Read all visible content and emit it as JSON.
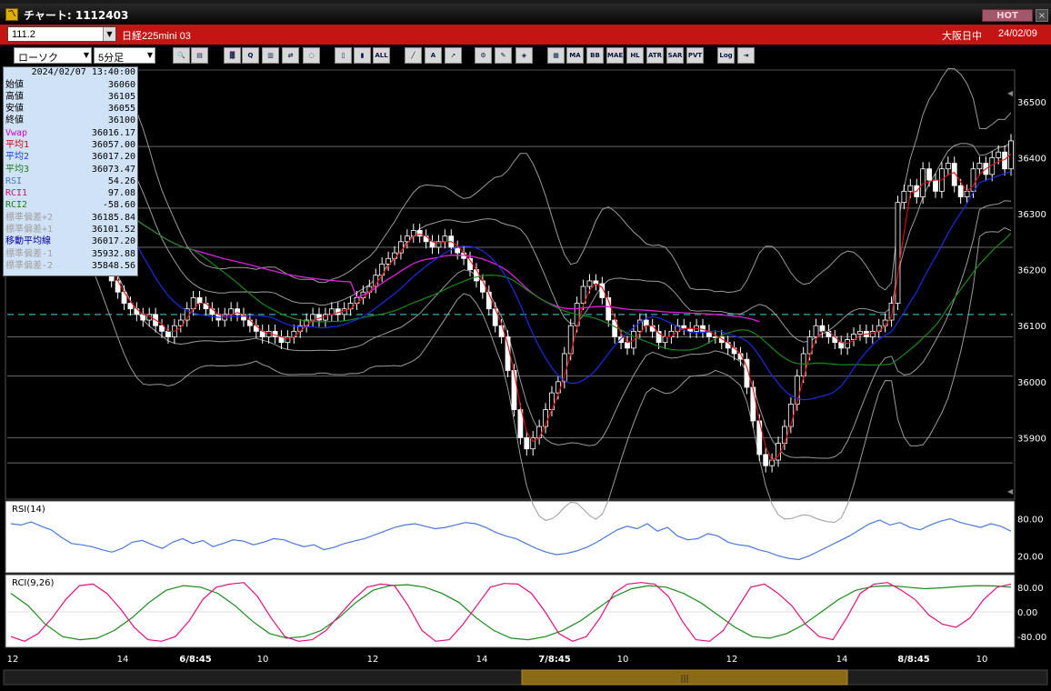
{
  "window": {
    "title": "チャート: 1112403",
    "hot_label": "HOT",
    "close_label": "×"
  },
  "instrument_bar": {
    "code": "111.2",
    "name": "日経225mini 03",
    "session": "大阪日中",
    "date": "24/02/09"
  },
  "toolbar": {
    "chart_type": "ローソク",
    "interval": "5分足",
    "buttons": [
      {
        "name": "zoom-icon",
        "label": "🔍"
      },
      {
        "name": "layout-icon",
        "label": "▤"
      },
      {
        "name": "candle-color-icon",
        "label": "▓"
      },
      {
        "name": "search-chart-icon",
        "label": "Q"
      },
      {
        "name": "bar-chart-icon",
        "label": "▥"
      },
      {
        "name": "swap-icon",
        "label": "⇄"
      },
      {
        "name": "disabled-tool-icon",
        "label": "◌"
      },
      {
        "name": "candle-type-a-icon",
        "label": "▯"
      },
      {
        "name": "candle-type-b-icon",
        "label": "▮"
      },
      {
        "name": "all-button",
        "label": "ALL"
      },
      {
        "name": "trendline-icon",
        "label": "╱"
      },
      {
        "name": "text-tool-icon",
        "label": "A"
      },
      {
        "name": "arrow-tool-icon",
        "label": "➚"
      },
      {
        "name": "settings-icon",
        "label": "⚙"
      },
      {
        "name": "color-tool-icon",
        "label": "✎"
      },
      {
        "name": "palette-icon",
        "label": "◈"
      },
      {
        "name": "grid-icon",
        "label": "▦"
      },
      {
        "name": "ma-button",
        "label": "MA"
      },
      {
        "name": "bb-button",
        "label": "BB"
      },
      {
        "name": "mae-button",
        "label": "MAE"
      },
      {
        "name": "hl-button",
        "label": "HL"
      },
      {
        "name": "atr-button",
        "label": "ATR"
      },
      {
        "name": "sar-button",
        "label": "SAR"
      },
      {
        "name": "pvt-button",
        "label": "PVT"
      },
      {
        "name": "log-button",
        "label": "Log"
      },
      {
        "name": "export-icon",
        "label": "⇥"
      }
    ]
  },
  "info_panel": {
    "timestamp": "2024/02/07  13:40:00",
    "rows": [
      {
        "label": "始値",
        "value": "36060",
        "color": "#000000"
      },
      {
        "label": "高値",
        "value": "36105",
        "color": "#000000"
      },
      {
        "label": "安値",
        "value": "36055",
        "color": "#000000"
      },
      {
        "label": "終値",
        "value": "36100",
        "color": "#000000"
      },
      {
        "label": "Vwap",
        "value": "36016.17",
        "color": "#cc00cc"
      },
      {
        "label": "平均1",
        "value": "36057.00",
        "color": "#d00000"
      },
      {
        "label": "平均2",
        "value": "36017.20",
        "color": "#1a3cd8"
      },
      {
        "label": "平均3",
        "value": "36073.47",
        "color": "#1a7a1a"
      },
      {
        "label": "RSI",
        "value": "54.26",
        "color": "#4a78c8"
      },
      {
        "label": "RCI1",
        "value": "97.08",
        "color": "#d0106a"
      },
      {
        "label": "RCI2",
        "value": "-58.60",
        "color": "#1a7a1a"
      },
      {
        "label": "標準偏差+2",
        "value": "36185.84",
        "color": "#a0a0a0"
      },
      {
        "label": "標準偏差+1",
        "value": "36101.52",
        "color": "#a0a0a0"
      },
      {
        "label": "移動平均線",
        "value": "36017.20",
        "color": "#0000a0"
      },
      {
        "label": "標準偏差-1",
        "value": "35932.88",
        "color": "#a0a0a0"
      },
      {
        "label": "標準偏差-2",
        "value": "35848.56",
        "color": "#a0a0a0"
      }
    ]
  },
  "price_axis": [
    "36500",
    "36400",
    "36300",
    "36200",
    "36100",
    "36000",
    "35900"
  ],
  "rsi_panel": {
    "title": "RSI(14)",
    "ticks": [
      "80.00",
      "20.00"
    ]
  },
  "rci_panel": {
    "title": "RCI(9,26)",
    "ticks": [
      "80.00",
      "0.00",
      "-80.00"
    ]
  },
  "time_axis": [
    "12",
    "14",
    "6/8:45",
    "10",
    "12",
    "14",
    "7/8:45",
    "10",
    "12",
    "14",
    "8/8:45",
    "10"
  ],
  "colors": {
    "candle": "#ffffff",
    "ma1": "#e01010",
    "ma2": "#1a2ce0",
    "ma3": "#1a8a1a",
    "vwap": "#e020e0",
    "bollinger": "#9a9a9a",
    "rsi": "#4a78d8",
    "rci1": "#e0107a",
    "rci2": "#1a8a1a",
    "dashed_level": "#2a9090",
    "scroll_thumb": "#8a6a14"
  },
  "chart_data": {
    "type": "candlestick",
    "price_range": [
      35800,
      36550
    ],
    "dashed_level": 36120,
    "horizontal_levels": [
      36420,
      36310,
      36240,
      36080,
      36010,
      35900,
      35855
    ],
    "closes": [
      36360,
      36370,
      36380,
      36365,
      36380,
      36390,
      36395,
      36400,
      36385,
      36370,
      36330,
      36290,
      36260,
      36240,
      36220,
      36200,
      36180,
      36160,
      36140,
      36130,
      36120,
      36110,
      36120,
      36100,
      36090,
      36080,
      36100,
      36110,
      36130,
      36150,
      36140,
      36130,
      36120,
      36110,
      36120,
      36130,
      36120,
      36110,
      36100,
      36090,
      36080,
      36090,
      36080,
      36070,
      36080,
      36090,
      36100,
      36110,
      36120,
      36110,
      36120,
      36130,
      36120,
      36130,
      36140,
      36150,
      36160,
      36170,
      36190,
      36210,
      36220,
      36230,
      36250,
      36260,
      36270,
      36260,
      36250,
      36240,
      36250,
      36260,
      36240,
      36230,
      36220,
      36200,
      36180,
      36160,
      36130,
      36100,
      36080,
      36020,
      35950,
      35900,
      35880,
      35900,
      35920,
      35950,
      35980,
      36000,
      36050,
      36100,
      36140,
      36170,
      36180,
      36175,
      36150,
      36110,
      36080,
      36070,
      36060,
      36090,
      36110,
      36100,
      36090,
      36070,
      36080,
      36090,
      36100,
      36095,
      36090,
      36100,
      36090,
      36080,
      36080,
      36070,
      36060,
      36050,
      36040,
      35990,
      35930,
      35870,
      35850,
      35860,
      35890,
      35920,
      35960,
      36010,
      36050,
      36080,
      36100,
      36090,
      36080,
      36070,
      36060,
      36075,
      36085,
      36090,
      36080,
      36090,
      36100,
      36110,
      36140,
      36320,
      36340,
      36350,
      36330,
      36380,
      36360,
      36340,
      36380,
      36390,
      36350,
      36330,
      36340,
      36380,
      36390,
      36370,
      36400,
      36410,
      36380,
      36430
    ],
    "rsi_range": [
      0,
      100
    ],
    "rsi": [
      72,
      70,
      75,
      68,
      62,
      50,
      40,
      38,
      35,
      30,
      26,
      32,
      42,
      45,
      38,
      32,
      42,
      48,
      40,
      45,
      35,
      40,
      46,
      44,
      38,
      42,
      48,
      46,
      40,
      35,
      38,
      30,
      34,
      40,
      44,
      48,
      54,
      60,
      66,
      70,
      72,
      68,
      64,
      66,
      70,
      74,
      72,
      66,
      58,
      52,
      48,
      40,
      32,
      26,
      22,
      24,
      28,
      34,
      42,
      52,
      62,
      68,
      64,
      72,
      60,
      66,
      52,
      46,
      48,
      56,
      52,
      42,
      38,
      36,
      30,
      26,
      20,
      16,
      14,
      20,
      28,
      36,
      44,
      52,
      62,
      72,
      78,
      70,
      74,
      66,
      62,
      70,
      76,
      80,
      74,
      70,
      66,
      72,
      68,
      60
    ],
    "rci_range": [
      -100,
      100
    ],
    "rci1": [
      -80,
      -95,
      -70,
      -20,
      40,
      85,
      90,
      60,
      10,
      -50,
      -90,
      -95,
      -80,
      -30,
      40,
      80,
      90,
      95,
      50,
      -20,
      -80,
      -95,
      -90,
      -60,
      -10,
      40,
      80,
      90,
      85,
      20,
      -60,
      -95,
      -90,
      -40,
      20,
      80,
      92,
      90,
      60,
      0,
      -70,
      -95,
      -80,
      -20,
      60,
      90,
      95,
      90,
      50,
      -30,
      -90,
      -95,
      -60,
      10,
      80,
      90,
      60,
      20,
      -40,
      -80,
      -90,
      -20,
      60,
      90,
      95,
      70,
      40,
      -10,
      -40,
      -50,
      -20,
      40,
      80,
      90
    ],
    "rci2": [
      60,
      20,
      -40,
      -80,
      -90,
      -85,
      -60,
      -20,
      30,
      70,
      85,
      80,
      60,
      20,
      -30,
      -70,
      -85,
      -80,
      -60,
      -20,
      30,
      70,
      85,
      88,
      80,
      60,
      30,
      -20,
      -60,
      -85,
      -90,
      -80,
      -60,
      -30,
      10,
      50,
      75,
      85,
      80,
      60,
      30,
      -10,
      -50,
      -80,
      -85,
      -70,
      -40,
      0,
      40,
      70,
      82,
      85,
      80,
      75,
      78,
      82,
      85,
      84,
      80
    ]
  },
  "scrollbar": {
    "thumb_label": "|||"
  }
}
